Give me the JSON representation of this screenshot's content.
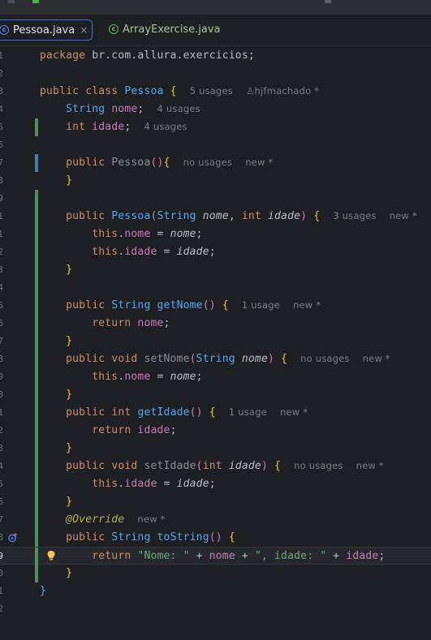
{
  "tabs": [
    {
      "label": "Pessoa.java",
      "close": "×",
      "icon": "c-class-icon"
    },
    {
      "label": "ArrayExercise.java",
      "icon": "class-run-icon"
    }
  ],
  "colors": {
    "background": "#1e1f22",
    "keyword": "#cf8e6d",
    "method": "#56a8f5",
    "field": "#c77dbb",
    "string": "#6aab73",
    "annotation": "#b3ae60",
    "gutter_added": "#549159",
    "gutter_modified": "#4c7ca6"
  },
  "lines": [
    {
      "num": "1"
    },
    {
      "num": "2"
    },
    {
      "num": "3"
    },
    {
      "num": "4"
    },
    {
      "num": "5"
    },
    {
      "num": "6"
    },
    {
      "num": "7"
    },
    {
      "num": "8"
    },
    {
      "num": "9"
    },
    {
      "num": "1"
    },
    {
      "num": "1"
    },
    {
      "num": "2"
    },
    {
      "num": "3"
    },
    {
      "num": "4"
    },
    {
      "num": "5"
    },
    {
      "num": "6"
    },
    {
      "num": "7"
    },
    {
      "num": "8"
    },
    {
      "num": "9"
    },
    {
      "num": "0"
    },
    {
      "num": "1"
    },
    {
      "num": "2"
    },
    {
      "num": "3"
    },
    {
      "num": "4"
    },
    {
      "num": "5"
    },
    {
      "num": "6"
    },
    {
      "num": "7"
    },
    {
      "num": "8"
    },
    {
      "num": "9"
    },
    {
      "num": "0"
    },
    {
      "num": "1"
    },
    {
      "num": "2"
    }
  ],
  "code": {
    "l1": {
      "kw": "package",
      "rest": " br.com.allura.exercicios;"
    },
    "l3": {
      "kw1": "public",
      "kw2": "class",
      "name": "Pessoa",
      "brace": "{",
      "usages": "5 usages",
      "author": "hjfmachado *"
    },
    "l4": {
      "type": "String",
      "field": "nome",
      "semi": ";",
      "usages": "4 usages"
    },
    "l5": {
      "type": "int",
      "field": "idade",
      "semi": ";",
      "usages": "4 usages"
    },
    "l7": {
      "kw": "public",
      "name": "Pessoa",
      "parens": "()",
      "brace": "{",
      "usages": "no usages",
      "new": "new *"
    },
    "l8": {
      "brace": "}"
    },
    "l10": {
      "kw": "public",
      "name": "Pessoa",
      "open": "(",
      "t1": "String",
      "p1": "nome",
      "comma": ",",
      "t2": "int",
      "p2": "idade",
      "close": ")",
      "brace": "{",
      "usages": "3 usages",
      "new": "new *"
    },
    "l11": {
      "this": "this",
      "dot": ".",
      "field": "nome",
      "eq": " = ",
      "param": "nome",
      "semi": ";"
    },
    "l12": {
      "this": "this",
      "dot": ".",
      "field": "idade",
      "eq": " = ",
      "param": "idade",
      "semi": ";"
    },
    "l13": {
      "brace": "}"
    },
    "l15": {
      "kw": "public",
      "type": "String",
      "name": "getNome",
      "parens": "()",
      "brace": "{",
      "usages": "1 usage",
      "new": "new *"
    },
    "l16": {
      "kw": "return",
      "field": "nome",
      "semi": ";"
    },
    "l17": {
      "brace": "}"
    },
    "l18": {
      "kw1": "public",
      "kw2": "void",
      "name": "setNome",
      "open": "(",
      "t1": "String",
      "p1": "nome",
      "close": ")",
      "brace": "{",
      "usages": "no usages",
      "new": "new *"
    },
    "l19": {
      "this": "this",
      "dot": ".",
      "field": "nome",
      "eq": " = ",
      "param": "nome",
      "semi": ";"
    },
    "l20": {
      "brace": "}"
    },
    "l21": {
      "kw1": "public",
      "kw2": "int",
      "name": "getIdade",
      "parens": "()",
      "brace": "{",
      "usages": "1 usage",
      "new": "new *"
    },
    "l22": {
      "kw": "return",
      "field": "idade",
      "semi": ";"
    },
    "l23": {
      "brace": "}"
    },
    "l24": {
      "kw1": "public",
      "kw2": "void",
      "name": "setIdade",
      "open": "(",
      "t1": "int",
      "p1": "idade",
      "close": ")",
      "brace": "{",
      "usages": "no usages",
      "new": "new *"
    },
    "l25": {
      "this": "this",
      "dot": ".",
      "field": "idade",
      "eq": " = ",
      "param": "idade",
      "semi": ";"
    },
    "l26": {
      "brace": "}"
    },
    "l27": {
      "ann": "@Override",
      "new": "new *"
    },
    "l28": {
      "kw": "public",
      "type": "String",
      "name": "toString",
      "parens": "()",
      "brace": "{"
    },
    "l29": {
      "kw": "return",
      "s1": "\"Nome: \"",
      "plus1": " + ",
      "f1": "nome",
      "plus2": " + ",
      "s2": "\", idade: \"",
      "plus3": " + ",
      "f2": "idade",
      "semi": ";"
    },
    "l30": {
      "brace": "}"
    },
    "l31": {
      "brace": "}"
    }
  }
}
